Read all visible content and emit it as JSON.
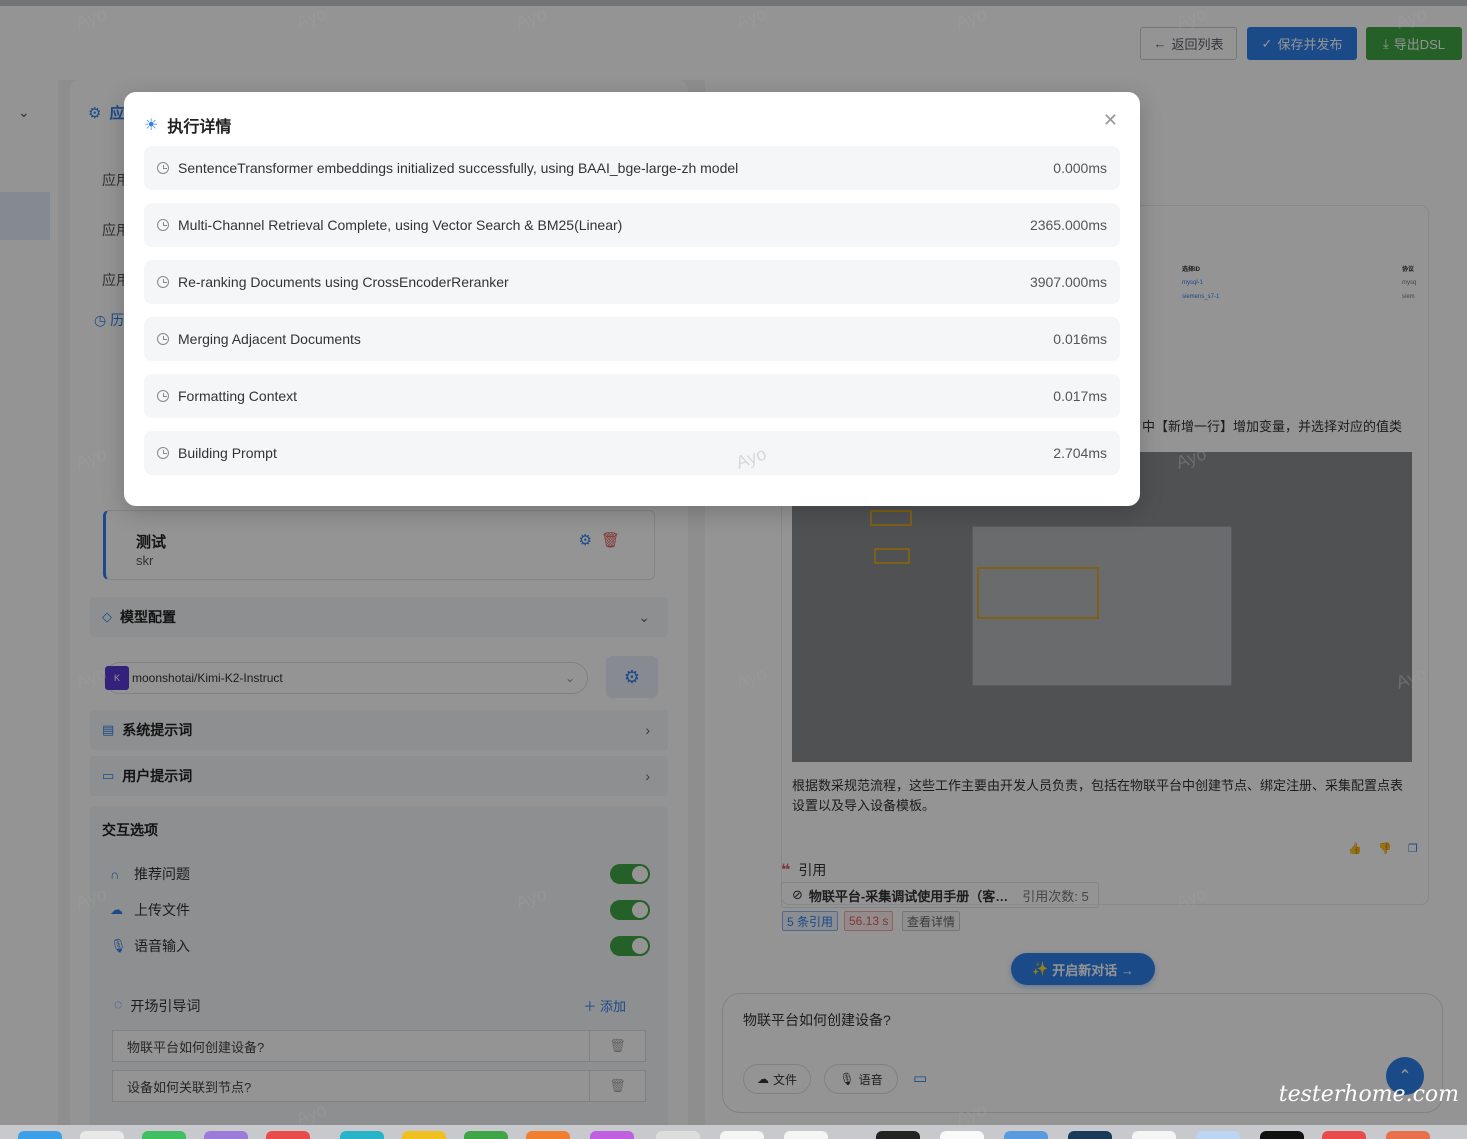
{
  "toolbar": {
    "back_label": "返回列表",
    "save_label": "保存并发布",
    "export_label": "导出DSL"
  },
  "left_panel": {
    "header_partial": "应",
    "rows": [
      "应用",
      "应用",
      "应用",
      "历"
    ],
    "kb_card": {
      "title": "测试",
      "subtitle": "skr"
    },
    "model_section": "模型配置",
    "model_name": "moonshotai/Kimi-K2-Instruct",
    "system_prompt": "系统提示词",
    "user_prompt": "用户提示词",
    "interaction": {
      "title": "交互选项",
      "options": [
        {
          "label": "推荐问题",
          "icon": "headset-icon",
          "enabled": true
        },
        {
          "label": "上传文件",
          "icon": "cloud-upload-icon",
          "enabled": true
        },
        {
          "label": "语音输入",
          "icon": "microphone-icon",
          "enabled": true
        }
      ]
    },
    "opener": {
      "title": "开场引导词",
      "add_label": "添加",
      "items": [
        "物联平台如何创建设备?",
        "设备如何关联到节点?"
      ]
    }
  },
  "chat": {
    "mini_table": {
      "headers": [
        "选择ID",
        "协议"
      ],
      "rows": [
        [
          "mysql-1",
          "mysq"
        ],
        [
          "siemens_s7-1",
          "siem"
        ]
      ]
    },
    "instruction_tail": "中【新增一行】增加变量，并选择对应的值类",
    "answer_paragraph": "根据数采规范流程，这些工作主要由开发人员负责，包括在物联平台中创建节点、绑定注册、采集配置点表设置以及导入设备模板。",
    "citation": {
      "title": "引用",
      "doc": "物联平台-采集调试使用手册（客…",
      "count_label": "引用次数: 5",
      "tag_refs": "5 条引用",
      "tag_time": "56.13 s",
      "tag_detail": "查看详情"
    },
    "new_chat_label": "开启新对话 →",
    "input_text": "物联平台如何创建设备?",
    "file_label": "文件",
    "voice_label": "语音"
  },
  "modal": {
    "title": "执行详情",
    "steps": [
      {
        "label": "SentenceTransformer embeddings initialized successfully, using BAAI_bge-large-zh model",
        "time": "0.000ms"
      },
      {
        "label": "Multi-Channel Retrieval Complete, using Vector Search & BM25(Linear)",
        "time": "2365.000ms"
      },
      {
        "label": "Re-ranking Documents using CrossEncoderReranker",
        "time": "3907.000ms"
      },
      {
        "label": "Merging Adjacent Documents",
        "time": "0.016ms"
      },
      {
        "label": "Formatting Context",
        "time": "0.017ms"
      },
      {
        "label": "Building Prompt",
        "time": "2.704ms"
      }
    ]
  },
  "watermark": "Ayo",
  "brand": "testerhome.com",
  "colors": {
    "accent": "#2f80ed",
    "success": "#3fa546",
    "danger": "#e25d5d"
  }
}
